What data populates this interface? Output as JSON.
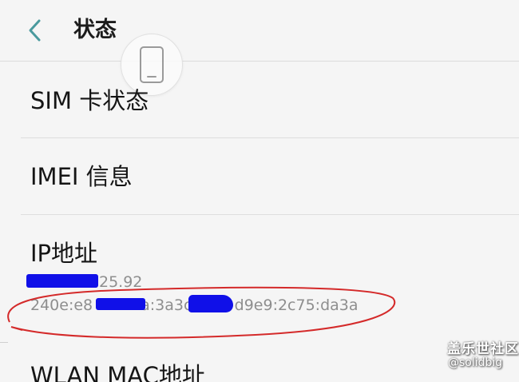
{
  "header": {
    "title": "状态",
    "back_icon": "chevron-left-icon"
  },
  "floating_button": {
    "icon": "phone-outline-icon"
  },
  "rows": [
    {
      "label": "SIM 卡状态"
    },
    {
      "label": "IMEI 信息"
    },
    {
      "label": "IP地址",
      "ipv4_visible": "25.92",
      "ipv6_prefix": "240e:e8",
      "ipv6_middle": "a:3a3c:f9",
      "ipv6_suffix": "d9e9:2c75:da3a"
    },
    {
      "label": "WLAN MAC地址"
    }
  ],
  "watermark": {
    "brand": "盖乐世社区",
    "handle": "@solidbig"
  },
  "colors": {
    "accent": "#4a9a9e",
    "annotation": "#d42a2a",
    "redaction": "#1010e8",
    "background": "#f5f5f5"
  }
}
